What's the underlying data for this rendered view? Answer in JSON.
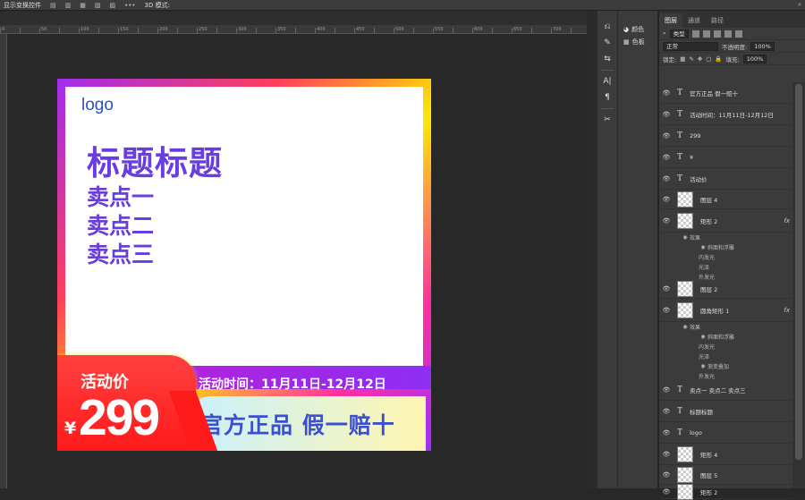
{
  "optbar": {
    "show_transform_controls": "显示变换控件",
    "mode_3d": "3D 模式:"
  },
  "ruler": {
    "ticks": [
      "0",
      "",
      "50",
      "",
      "100",
      "",
      "150",
      "",
      "200",
      "",
      "250",
      "",
      "300",
      "",
      "350",
      "",
      "400",
      "",
      "450",
      "",
      "500",
      "",
      "550",
      "",
      "600",
      "",
      "650",
      "",
      "700",
      "",
      "750",
      "",
      "800"
    ]
  },
  "swatches": {
    "color_label": "颜色",
    "swatch_label": "色板"
  },
  "layers_panel": {
    "tabs": [
      "图层",
      "通道",
      "路径"
    ],
    "filter_kind": "类型",
    "blend_mode": "正常",
    "opacity_label": "不透明度:",
    "opacity_value": "100%",
    "lock_label": "锁定:",
    "fill_label": "填充:",
    "fill_value": "100%",
    "layers": [
      {
        "kind": "text",
        "name": "官方正品  假一赔十"
      },
      {
        "kind": "text",
        "name": "活动时间：11月11日-12月12日"
      },
      {
        "kind": "text",
        "name": "299"
      },
      {
        "kind": "text",
        "name": "¥"
      },
      {
        "kind": "text",
        "name": "活动价"
      },
      {
        "kind": "image",
        "name": "图层 4"
      },
      {
        "kind": "shape",
        "name": "矩形 2",
        "fx": "fx"
      },
      {
        "kind": "image",
        "name": "图层 2"
      },
      {
        "kind": "shape",
        "name": "圆角矩形 1",
        "fx": "fx"
      },
      {
        "kind": "text",
        "name": "卖点一  卖点二  卖点三"
      },
      {
        "kind": "text",
        "name": "标题标题"
      },
      {
        "kind": "text",
        "name": "logo"
      },
      {
        "kind": "shape",
        "name": "矩形 4"
      },
      {
        "kind": "image",
        "name": "图层 5"
      },
      {
        "kind": "shape",
        "name": "矩形 2"
      }
    ],
    "effects_a": [
      "效果",
      "斜面和浮雕",
      "内发光",
      "光泽",
      "外发光"
    ],
    "effects_b": [
      "效果",
      "斜面和浮雕",
      "内发光",
      "光泽",
      "渐变叠加",
      "外发光"
    ]
  },
  "ad": {
    "logo": "logo",
    "title": "标题标题",
    "selling_points": [
      "卖点一",
      "卖点二",
      "卖点三"
    ],
    "activity_label": "活动价",
    "currency": "¥",
    "price": "299",
    "activity_time": "活动时间：11月11日-12月12日",
    "slogan": "官方正品  假一赔十"
  },
  "colors": {
    "ad_purple": "#6a3de0",
    "ad_red": "#ff1a1a",
    "ad_blue": "#3a4fd4"
  }
}
